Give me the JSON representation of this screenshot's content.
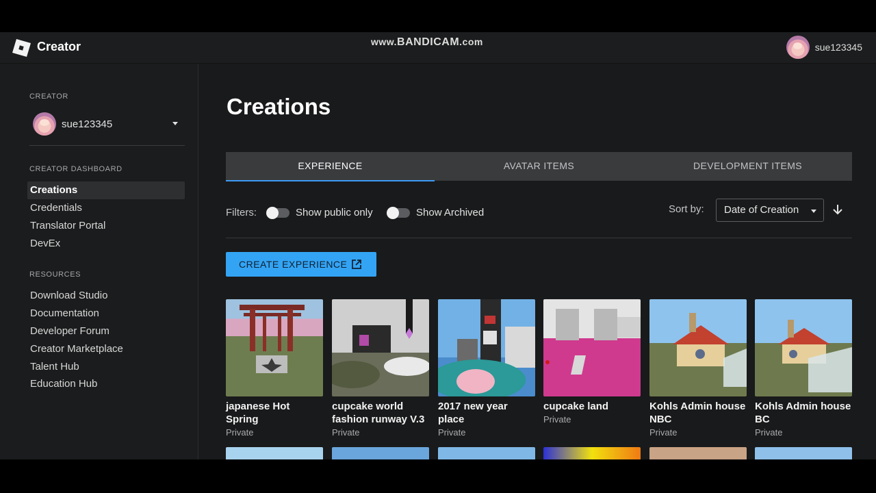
{
  "topbar": {
    "brand": "Creator",
    "watermark_prefix": "www.",
    "watermark_main": "BANDICAM",
    "watermark_suffix": ".com",
    "username": "sue123345"
  },
  "sidebar": {
    "creator_heading": "CREATOR",
    "username": "sue123345",
    "dashboard_heading": "CREATOR DASHBOARD",
    "dashboard_items": [
      {
        "label": "Creations",
        "active": true
      },
      {
        "label": "Credentials"
      },
      {
        "label": "Translator Portal"
      },
      {
        "label": "DevEx"
      }
    ],
    "resources_heading": "RESOURCES",
    "resource_items": [
      {
        "label": "Download Studio"
      },
      {
        "label": "Documentation"
      },
      {
        "label": "Developer Forum"
      },
      {
        "label": "Creator Marketplace"
      },
      {
        "label": "Talent Hub"
      },
      {
        "label": "Education Hub"
      }
    ]
  },
  "main": {
    "title": "Creations",
    "tabs": [
      {
        "label": "EXPERIENCE",
        "active": true
      },
      {
        "label": "AVATAR ITEMS"
      },
      {
        "label": "DEVELOPMENT ITEMS"
      }
    ],
    "filters_label": "Filters:",
    "toggle_public": "Show public only",
    "toggle_archived": "Show Archived",
    "sort_label": "Sort by:",
    "sort_value": "Date of Creation",
    "create_button": "CREATE EXPERIENCE",
    "experiences": [
      {
        "name": "japanese Hot Spring",
        "status": "Private"
      },
      {
        "name": "cupcake world fashion runway V.3",
        "status": "Private"
      },
      {
        "name": "2017 new year place",
        "status": "Private"
      },
      {
        "name": "cupcake land",
        "status": "Private"
      },
      {
        "name": "Kohls Admin house NBC",
        "status": "Private"
      },
      {
        "name": "Kohls Admin house BC",
        "status": "Private"
      }
    ]
  },
  "colors": {
    "accent": "#33a4f4",
    "tab_underline": "#3d9bf5",
    "background": "#191a1b"
  }
}
